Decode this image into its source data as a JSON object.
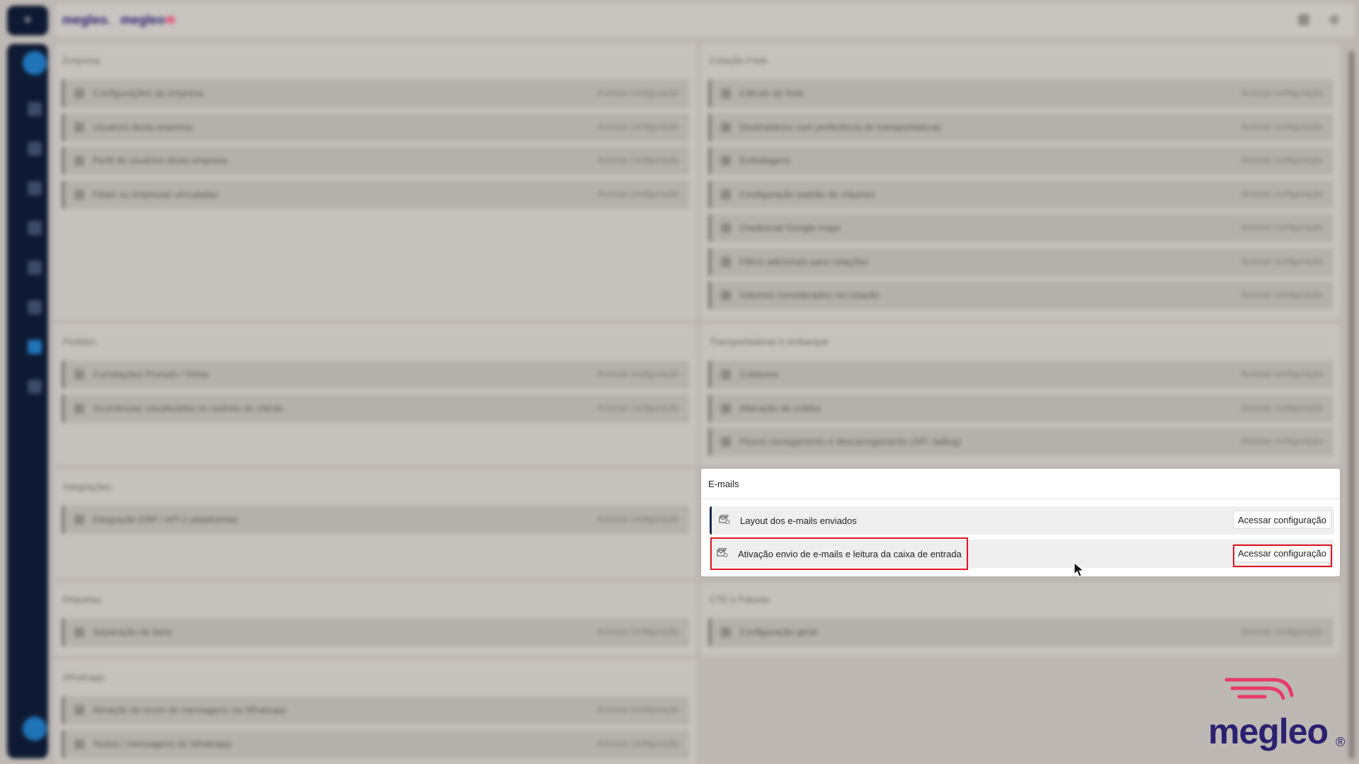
{
  "background": {
    "topbar": {
      "logo_a": "megleo.",
      "logo_b": "megleo"
    },
    "sidebar": {
      "top_glyph": "≡"
    },
    "panels": [
      {
        "title": "Empresa",
        "rows": [
          "Configurações da empresa",
          "Usuários desta empresa",
          "Perfil de usuários desta empresa",
          "Filiais ou empresas vinculadas"
        ],
        "action": "Acessar configuração"
      },
      {
        "title": "Cotação Frete",
        "rows": [
          "Cálculo de frete",
          "Destinatários com preferência de transportadoras",
          "Embalagens",
          "Configuração padrão de volumes",
          "Credencial Google maps",
          "Filtros adicionais para cotações",
          "Volumes considerados na cotação"
        ],
        "action": "Acessar configuração"
      },
      {
        "title": "Pedidos",
        "rows": [
          "Correlações Pronutri / Vtrine",
          "Ocorrências visualizadas no rastreio do cliente"
        ],
        "action": "Acessar configuração"
      },
      {
        "title": "Transportadoras e embarque",
        "rows": [
          "Coletores",
          "Alteração de coletor",
          "Fluxos carregamento e descarregamento (API Jadlog)"
        ],
        "action": "Acessar configuração"
      },
      {
        "title": "Integrações",
        "rows": [
          "Integração ERP / API e plataformas"
        ],
        "action": "Acessar configuração"
      },
      {
        "title": "Etiquetas",
        "rows": [
          "Separação de itens"
        ],
        "action": "Acessar configuração"
      },
      {
        "title": "CTE e Faturas",
        "rows": [
          "Configuração geral"
        ],
        "action": "Acessar configuração"
      },
      {
        "title": "Whatsapp",
        "rows": [
          "Ativação do envio de mensagens via Whatsapp",
          "Textos / mensagens do Whatsapp"
        ],
        "action": "Acessar configuração"
      }
    ]
  },
  "emails": {
    "title": "E-mails",
    "rows": [
      {
        "label": "Layout dos e-mails enviados",
        "action": "Acessar configuração"
      },
      {
        "label": "Ativação envio de e-mails e leitura da caixa de entrada",
        "action": "Acessar configuração"
      }
    ]
  },
  "logo": {
    "text": "megleo",
    "reg": "®"
  },
  "colors": {
    "brand_navy": "#2b2170",
    "brand_pink": "#e63b6a",
    "highlight_red": "#e0141f",
    "sidebar": "#0e1a33"
  }
}
